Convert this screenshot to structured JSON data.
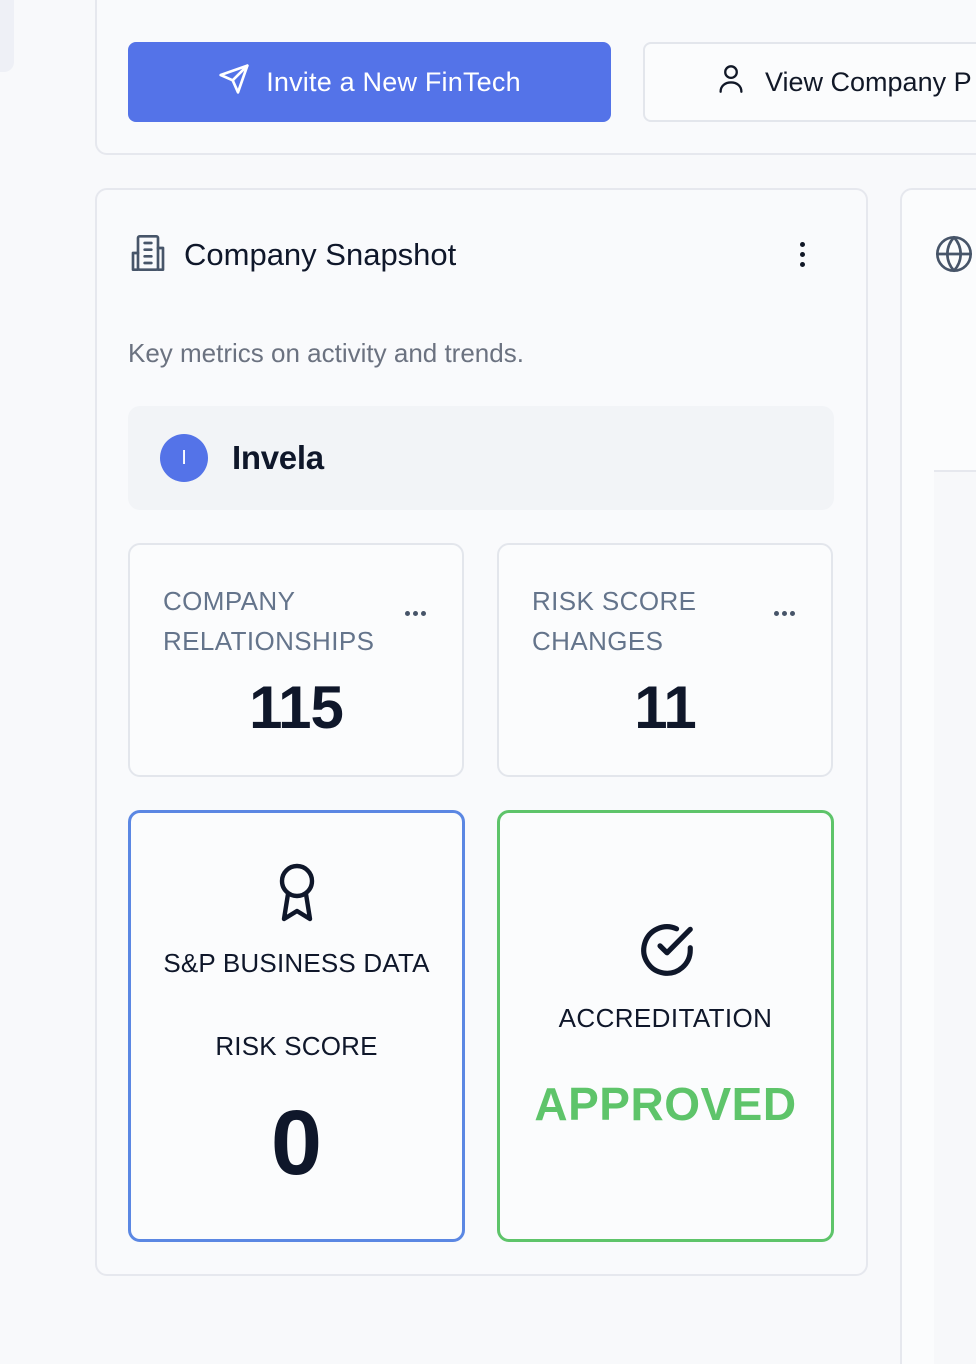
{
  "actions": {
    "invite_label": "Invite a New FinTech",
    "view_company_label": "View Company P"
  },
  "snapshot": {
    "title": "Company Snapshot",
    "description": "Key metrics on activity and trends.",
    "company": {
      "initial": "I",
      "name": "Invela"
    },
    "metrics": [
      {
        "label": "COMPANY RELATIONSHIPS",
        "value": "115"
      },
      {
        "label": "RISK SCORE CHANGES",
        "value": "11"
      }
    ],
    "risk_score": {
      "title": "S&P BUSINESS DATA",
      "subtitle": "RISK SCORE",
      "value": "0",
      "accent": "#5b87e3"
    },
    "accreditation": {
      "title": "ACCREDITATION",
      "status": "APPROVED",
      "accent": "#5ec46a"
    }
  },
  "icons": {
    "invite": "send-icon",
    "view_company": "user-icon",
    "snapshot": "building-icon",
    "risk": "award-icon",
    "accreditation": "check-circle-icon",
    "right_card": "globe-icon"
  },
  "colors": {
    "primary": "#5473e8",
    "success": "#5ec46a"
  }
}
